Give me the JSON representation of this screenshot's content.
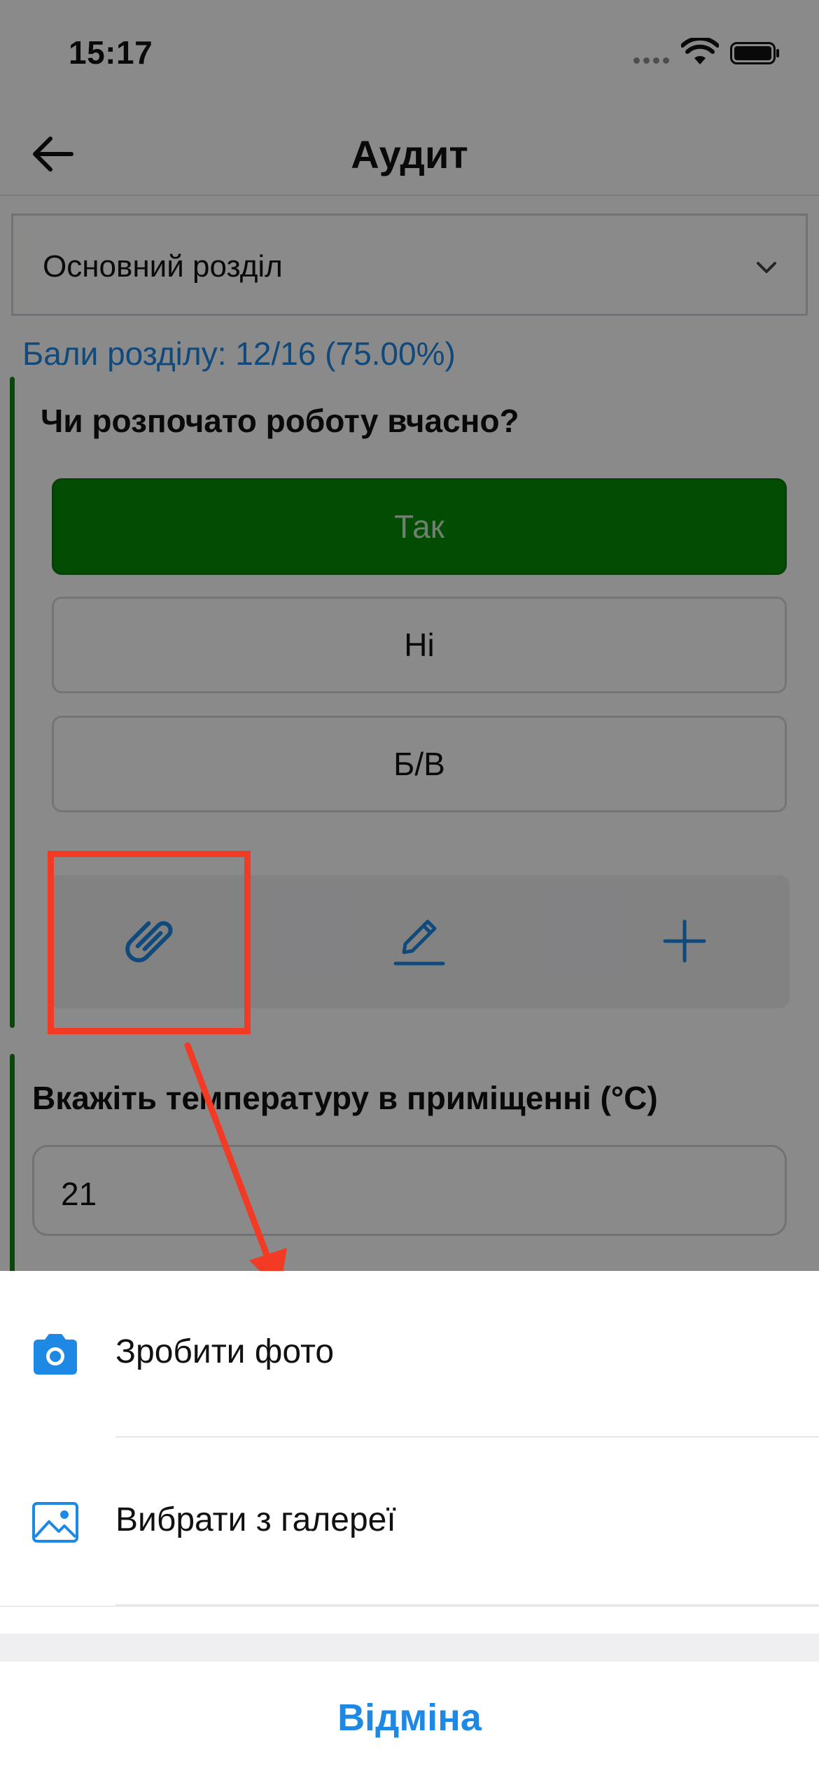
{
  "status_bar": {
    "time": "15:17"
  },
  "nav": {
    "title": "Аудит"
  },
  "section_select": {
    "value": "Основний розділ"
  },
  "score": {
    "text": "Бали розділу: 12/16 (75.00%)"
  },
  "question1": {
    "title": "Чи розпочато роботу вчасно?",
    "answers": [
      "Так",
      "Ні",
      "Б/В"
    ],
    "selected_answer": "Так"
  },
  "question2": {
    "title": "Вкажіть температуру в приміщенні (°C)",
    "value": "21"
  },
  "action_sheet": {
    "take_photo": "Зробити фото",
    "choose_gallery": "Вибрати з галереї",
    "cancel": "Відміна"
  },
  "colors": {
    "accent": "#1e88e5",
    "selected_answer": "#068c06",
    "card_bar": "#1b7f1b",
    "annotation": "#f33a24"
  },
  "icons": {
    "back": "arrow-left-icon",
    "dropdown": "chevron-down-icon",
    "attach": "paperclip-icon",
    "edit": "pencil-icon",
    "add": "plus-icon",
    "camera": "camera-icon",
    "gallery": "image-icon"
  }
}
